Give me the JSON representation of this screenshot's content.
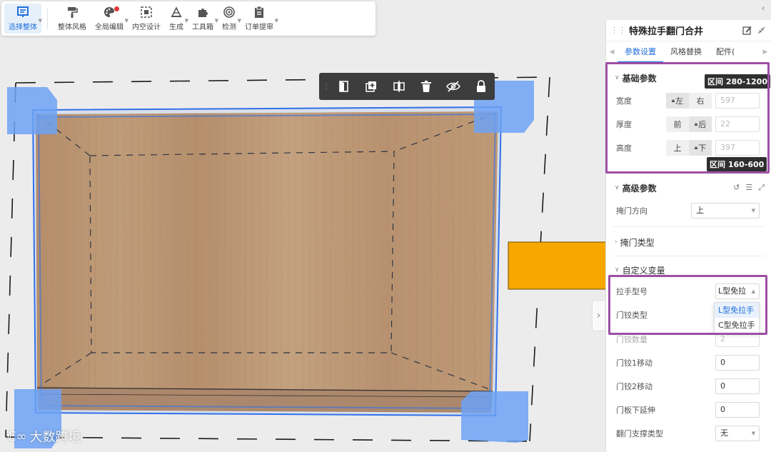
{
  "toolbar": {
    "items": [
      {
        "label": "选择整体",
        "icon": "select-whole-icon",
        "active": true
      },
      {
        "label": "整体风格",
        "icon": "paint-roller-icon"
      },
      {
        "label": "全局编辑",
        "icon": "palette-icon",
        "badge": true
      },
      {
        "label": "内空设计",
        "icon": "inner-space-icon"
      },
      {
        "label": "生成",
        "icon": "generate-icon"
      },
      {
        "label": "工具箱",
        "icon": "puzzle-icon"
      },
      {
        "label": "检测",
        "icon": "detect-icon"
      },
      {
        "label": "订单提审",
        "icon": "clipboard-icon"
      }
    ]
  },
  "object_toolbar": {
    "buttons": [
      "door-icon",
      "add-box-icon",
      "mirror-icon",
      "trash-icon",
      "eye-hidden-icon",
      "lock-icon"
    ]
  },
  "watermark": {
    "logo": "ℂ∞",
    "text": "大数跨境"
  },
  "panel": {
    "title": "特殊拉手翻门合井",
    "tabs": [
      "参数设置",
      "风格替换",
      "配件("
    ],
    "active_tab": 0,
    "basic": {
      "title": "基础参数",
      "width": {
        "label": "宽度",
        "opt1": "左",
        "opt2": "右",
        "locked": "left",
        "value": "597"
      },
      "thickness": {
        "label": "厚度",
        "opt1": "前",
        "opt2": "后",
        "locked": "right",
        "value": "22"
      },
      "height": {
        "label": "高度",
        "opt1": "上",
        "opt2": "下",
        "locked": "right",
        "value": "397"
      },
      "tooltip_width": "区间 280-1200",
      "tooltip_height": "区间 160-600"
    },
    "advanced": {
      "title": "高级参数",
      "direction_label": "掩门方向",
      "direction_value": "上"
    },
    "door_type": {
      "title": "掩门类型"
    },
    "custom": {
      "title": "自定义变量",
      "handle_label": "拉手型号",
      "handle_value": "L型免拉",
      "handle_options": [
        "L型免拉手",
        "C型免拉手"
      ],
      "hinge_type_label": "门铰类型",
      "hinge_count_label": "门铰数量",
      "hinge_count_value": "2",
      "hinge1_label": "门铰1移动",
      "hinge1_value": "0",
      "hinge2_label": "门铰2移动",
      "hinge2_value": "0",
      "extend_label": "门板下延伸",
      "extend_value": "0",
      "support_label": "翻门支撑类型",
      "support_value": "无"
    }
  },
  "colors": {
    "accent": "#1e6fd9",
    "highlight": "#9c4fa3",
    "wood": "#c9955e",
    "selection": "#4a86f2",
    "orange": "#f7a800"
  }
}
